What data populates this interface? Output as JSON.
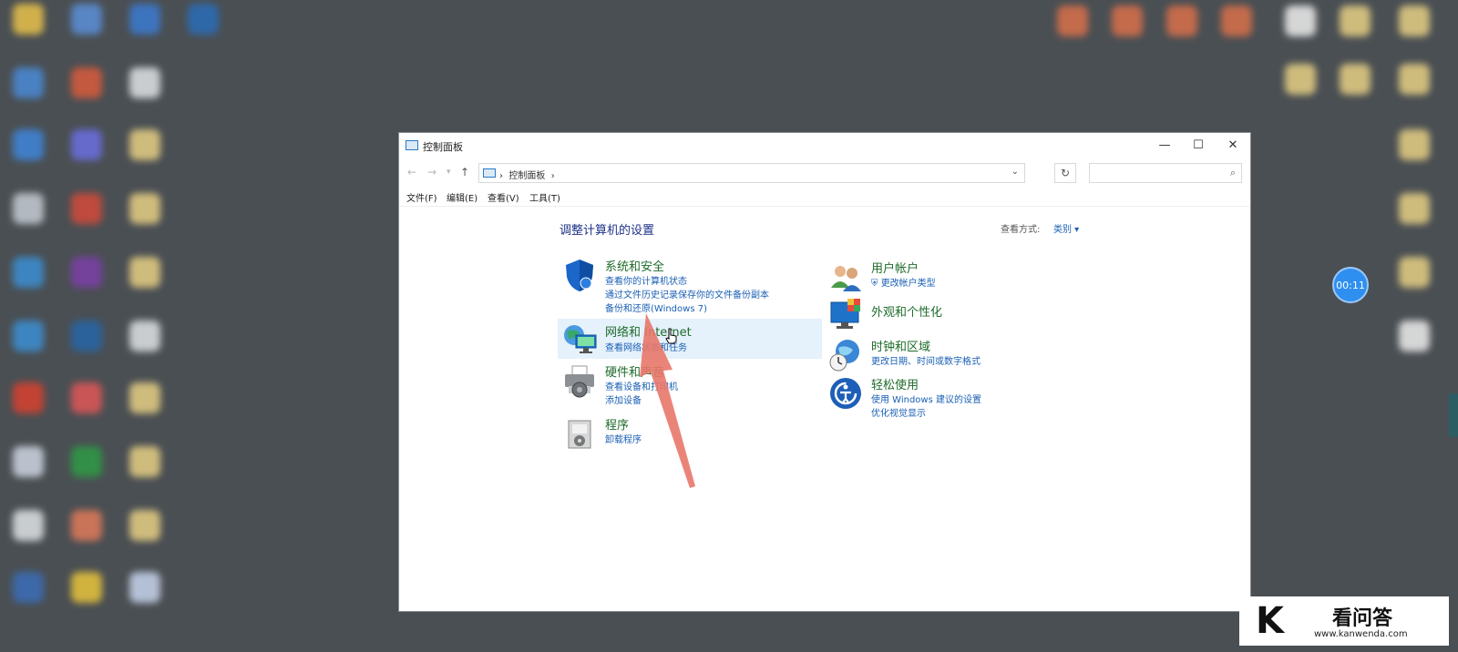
{
  "window": {
    "title": "控制面板",
    "controls": {
      "minimize": "—",
      "maximize": "☐",
      "close": "✕"
    }
  },
  "address": {
    "path": "控制面板",
    "separator": "›",
    "search_placeholder": ""
  },
  "menu": [
    "文件(F)",
    "编辑(E)",
    "查看(V)",
    "工具(T)"
  ],
  "main": {
    "heading": "调整计算机的设置",
    "view_by_label": "查看方式:",
    "view_by_value": "类别 ▾"
  },
  "categories_left": [
    {
      "title": "系统和安全",
      "links": [
        "查看你的计算机状态",
        "通过文件历史记录保存你的文件备份副本",
        "备份和还原(Windows 7)"
      ]
    },
    {
      "title": "网络和 Internet",
      "links": [
        "查看网络状态和任务"
      ]
    },
    {
      "title": "硬件和声音",
      "links": [
        "查看设备和打印机",
        "添加设备"
      ]
    },
    {
      "title": "程序",
      "links": [
        "卸载程序"
      ]
    }
  ],
  "categories_right": [
    {
      "title": "用户帐户",
      "links": [
        "更改帐户类型"
      ]
    },
    {
      "title": "外观和个性化",
      "links": []
    },
    {
      "title": "时钟和区域",
      "links": [
        "更改日期、时间或数字格式"
      ]
    },
    {
      "title": "轻松使用",
      "links": [
        "使用 Windows 建议的设置",
        "优化视觉显示"
      ]
    }
  ],
  "overlay": {
    "timer": "00:11"
  },
  "watermark": {
    "name": "看问答",
    "url": "www.kanwenda.com"
  },
  "colors": {
    "accent_link": "#1a5fb4",
    "category_title": "#1e6b2a",
    "hover_bg": "#e5f1fb",
    "arrow": "#e8776a"
  }
}
